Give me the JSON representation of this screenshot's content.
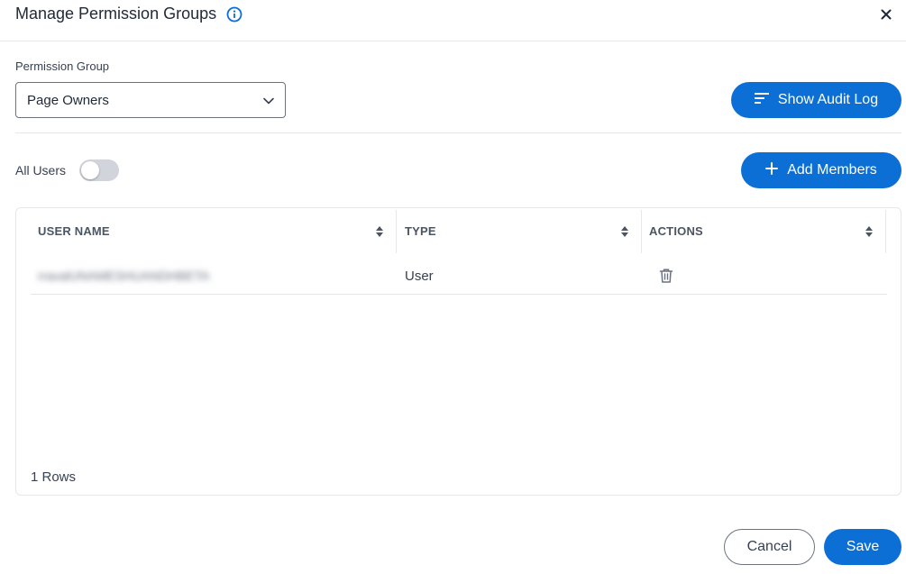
{
  "dialog": {
    "title": "Manage Permission Groups",
    "close_glyph": "×"
  },
  "permission_group": {
    "label": "Permission Group",
    "selected": "Page Owners"
  },
  "actions": {
    "audit_log_label": "Show Audit Log",
    "add_members_label": "Add Members"
  },
  "all_users": {
    "label": "All Users",
    "enabled": false
  },
  "table": {
    "columns": [
      "USER NAME",
      "TYPE",
      "ACTIONS"
    ],
    "rows": [
      {
        "user_name": "rravalUNAMESHUANDHBETA",
        "type": "User"
      }
    ],
    "rows_count": "1 Rows"
  },
  "footer": {
    "cancel_label": "Cancel",
    "save_label": "Save"
  },
  "colors": {
    "primary": "#0b6fd6",
    "border": "#e5e7eb",
    "text": "#1f2937"
  },
  "icons": {
    "info": "info-circle-icon",
    "close": "close-icon",
    "chevron": "chevron-down-icon",
    "audit": "list-lines-icon",
    "add": "plus-icon",
    "sort": "sort-icon",
    "delete": "trash-icon"
  }
}
